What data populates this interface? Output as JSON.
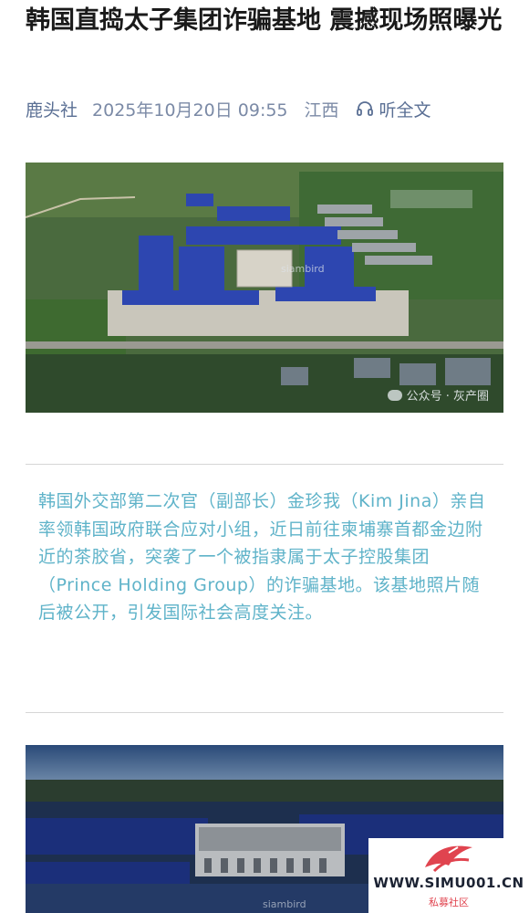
{
  "article": {
    "title": "韩国直捣太子集团诈骗基地 震撼现场照曝光",
    "source": "鹿头社",
    "datetime": "2025年10月20日 09:55",
    "region": "江西",
    "listen_label": "听全文"
  },
  "images": [
    {
      "watermark": "公众号 · 灰产圈",
      "overlay_text": "siambird"
    },
    {
      "overlay_text": "siambird"
    }
  ],
  "quote": "韩国外交部第二次官（副部长）金珍我（Kim Jina）亲自率领韩国政府联合应对小组，近日前往柬埔寨首都金边附近的茶胶省，突袭了一个被指隶属于太子控股集团（Prince Holding Group）的诈骗基地。该基地照片随后被公开，引发国际社会高度关注。",
  "site_logo": {
    "url_text": "WWW.SIMU001.CN",
    "sub_text": "私募社区"
  },
  "colors": {
    "accent": "#5a6f94",
    "quote_text": "#5fb3c9",
    "roof_blue": "#2d46b0",
    "logo_red": "#e0444f"
  },
  "icons": [
    "headphones-icon",
    "wechat-icon"
  ]
}
